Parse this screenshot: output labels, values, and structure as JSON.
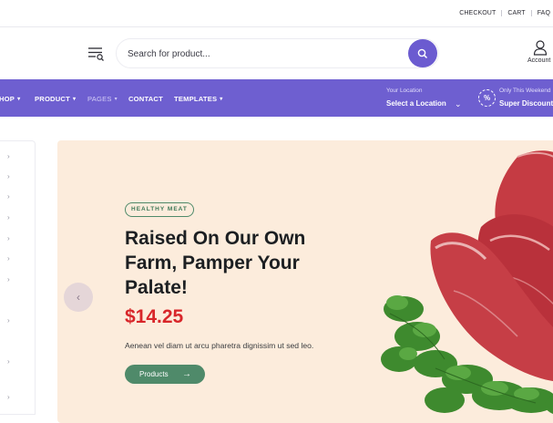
{
  "top_links": [
    "CHECKOUT",
    "CART",
    "FAQ"
  ],
  "search": {
    "placeholder": "Search for product..."
  },
  "account_label": "Account",
  "nav": {
    "items": [
      {
        "label": "HOP",
        "caret": "▾",
        "dim": false
      },
      {
        "label": "PRODUCT",
        "caret": "▾",
        "dim": false
      },
      {
        "label": "PAGES",
        "caret": "▾",
        "dim": true
      },
      {
        "label": "CONTACT",
        "caret": "",
        "dim": false
      },
      {
        "label": "TEMPLATES",
        "caret": "▾",
        "dim": false
      }
    ],
    "location_small": "Your Location",
    "location_big": "Select a Location",
    "deal_small": "Only This Weekend",
    "deal_big": "Super Discount",
    "deal_badge": "%"
  },
  "hero": {
    "tag": "HEALTHY MEAT",
    "headline": "Raised On Our Own Farm, Pamper Your Palate!",
    "price": "$14.25",
    "description": "Aenean vel diam ut arcu pharetra dignissim ut sed leo.",
    "cta_label": "Products"
  },
  "colors": {
    "nav": "#6e5fd0",
    "accent_green": "#4f8a6a",
    "price_red": "#d8262a",
    "hero_bg": "#fcecdc"
  },
  "icons": [
    "menu-filter-icon",
    "search-icon",
    "user-icon",
    "chevron-right-icon",
    "chevron-left-icon",
    "arrow-right-icon",
    "percent-badge-icon"
  ]
}
